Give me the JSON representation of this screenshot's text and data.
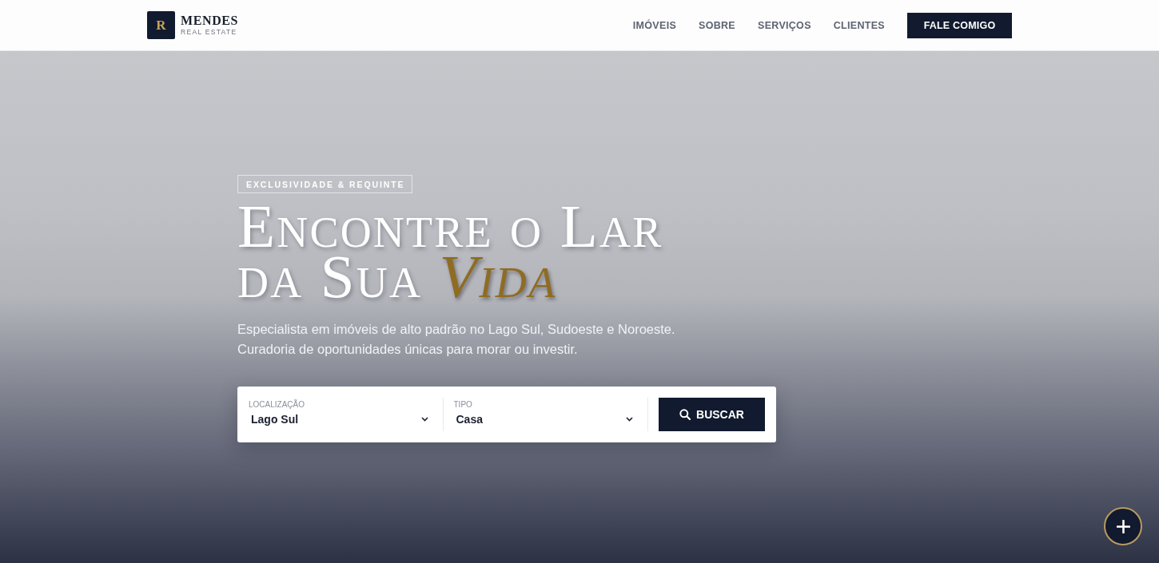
{
  "header": {
    "logo": {
      "mark": "R",
      "name": "MENDES",
      "tagline": "REAL ESTATE"
    },
    "nav": [
      "IMÓVEIS",
      "SOBRE",
      "SERVIÇOS",
      "CLIENTES"
    ],
    "cta": "FALE COMIGO"
  },
  "hero": {
    "badge": "EXCLUSIVIDADE & REQUINTE",
    "heading": [
      "Encontre o Lar",
      "da Sua *Vida*"
    ],
    "subtitle": [
      "Especialista em imóveis de alto padrão no Lago Sul, Sudoeste e Noroeste.",
      "Curadoria de oportunidades únicas para morar ou investir."
    ],
    "search": {
      "fields": [
        {
          "label": "LOCALIZAÇÃO",
          "value": "Lago Sul"
        },
        {
          "label": "TIPO",
          "value": "Casa"
        }
      ],
      "button": "BUSCAR"
    }
  }
}
